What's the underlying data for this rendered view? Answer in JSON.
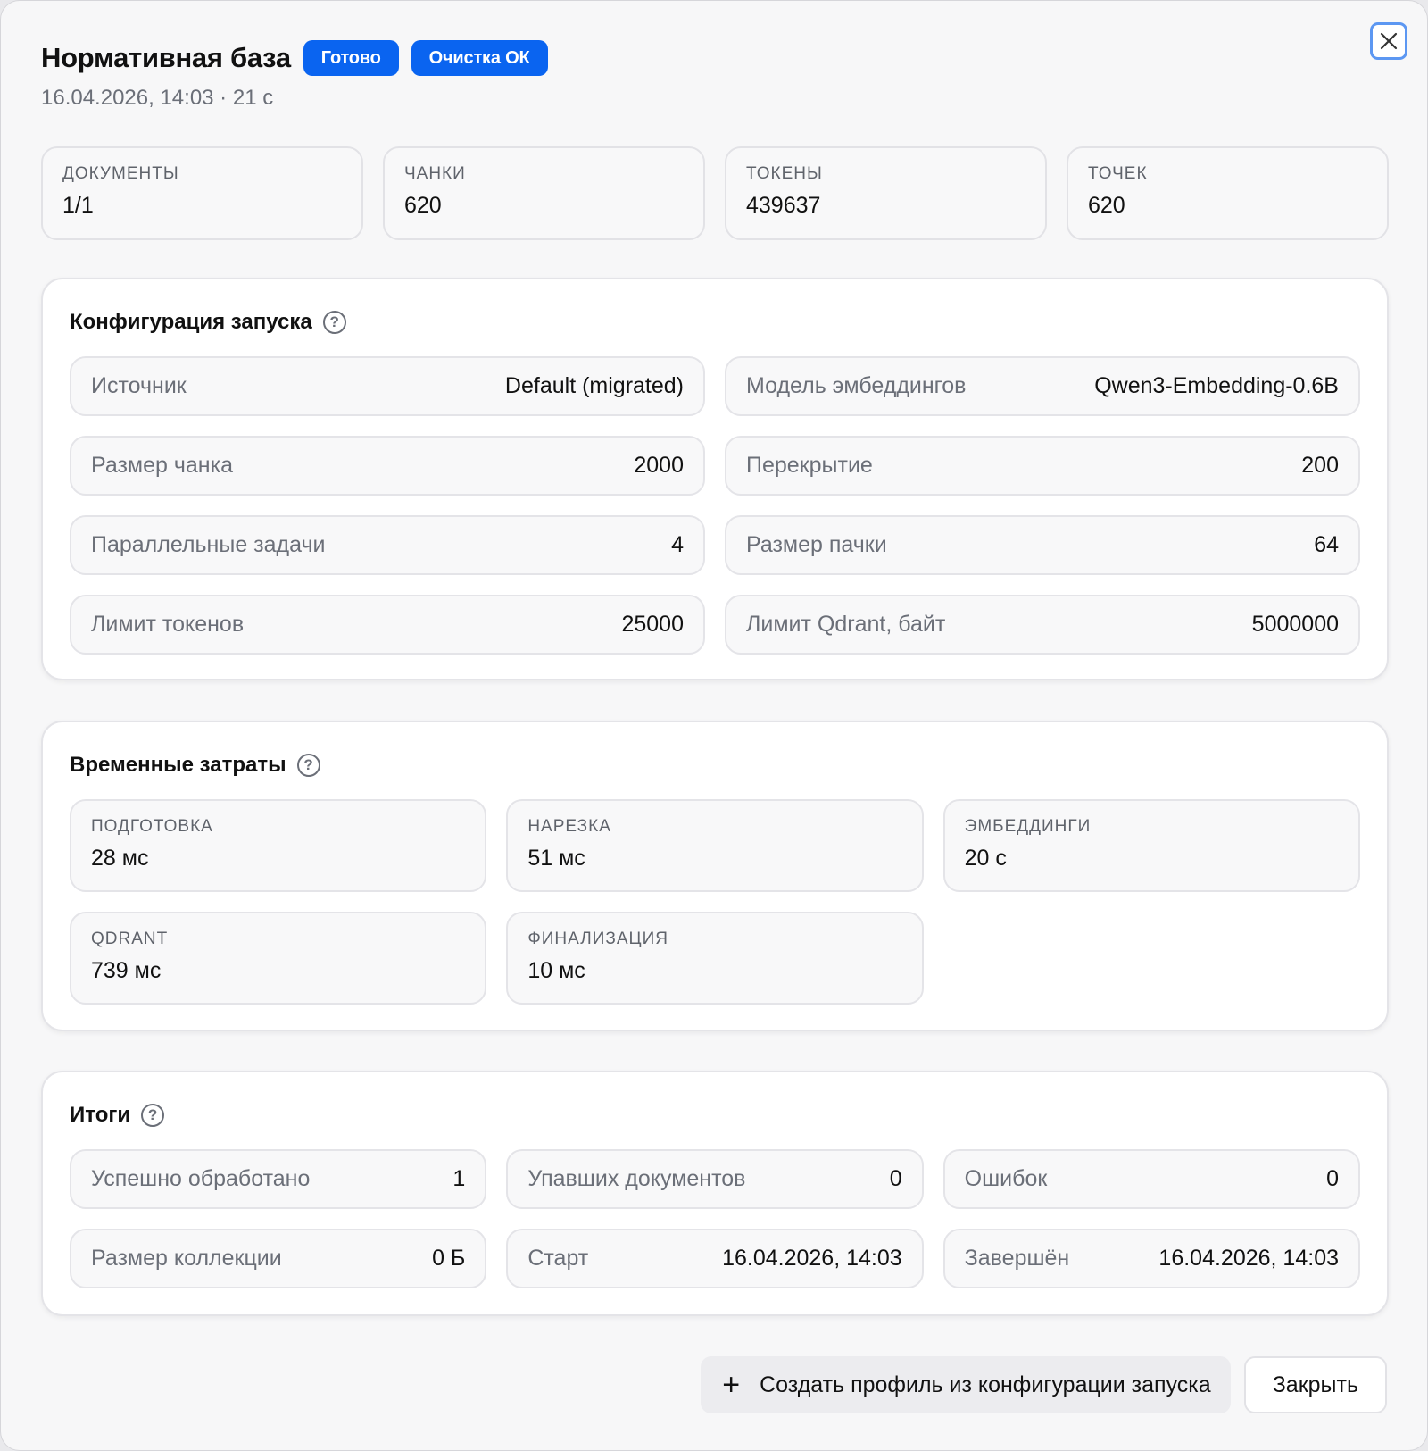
{
  "header": {
    "title": "Нормативная база",
    "badge_status": "Готово",
    "badge_cleanup": "Очистка ОК",
    "subtitle": "16.04.2026, 14:03 · 21 с"
  },
  "stats": [
    {
      "label": "ДОКУМЕНТЫ",
      "value": "1/1"
    },
    {
      "label": "ЧАНКИ",
      "value": "620"
    },
    {
      "label": "ТОКЕНЫ",
      "value": "439637"
    },
    {
      "label": "ТОЧЕК",
      "value": "620"
    }
  ],
  "config": {
    "title": "Конфигурация запуска",
    "rows": [
      {
        "label": "Источник",
        "value": "Default (migrated)"
      },
      {
        "label": "Модель эмбеддингов",
        "value": "Qwen3-Embedding-0.6B"
      },
      {
        "label": "Размер чанка",
        "value": "2000"
      },
      {
        "label": "Перекрытие",
        "value": "200"
      },
      {
        "label": "Параллельные задачи",
        "value": "4"
      },
      {
        "label": "Размер пачки",
        "value": "64"
      },
      {
        "label": "Лимит токенов",
        "value": "25000"
      },
      {
        "label": "Лимит Qdrant, байт",
        "value": "5000000"
      }
    ]
  },
  "timing": {
    "title": "Временные затраты",
    "cards": [
      {
        "label": "ПОДГОТОВКА",
        "value": "28 мс"
      },
      {
        "label": "НАРЕЗКА",
        "value": "51 мс"
      },
      {
        "label": "ЭМБЕДДИНГИ",
        "value": "20 с"
      },
      {
        "label": "QDRANT",
        "value": "739 мс"
      },
      {
        "label": "ФИНАЛИЗАЦИЯ",
        "value": "10 мс"
      }
    ]
  },
  "totals": {
    "title": "Итоги",
    "rows": [
      {
        "label": "Успешно обработано",
        "value": "1"
      },
      {
        "label": "Упавших документов",
        "value": "0"
      },
      {
        "label": "Ошибок",
        "value": "0"
      },
      {
        "label": "Размер коллекции",
        "value": "0 Б"
      },
      {
        "label": "Старт",
        "value": "16.04.2026, 14:03"
      },
      {
        "label": "Завершён",
        "value": "16.04.2026, 14:03"
      }
    ]
  },
  "footer": {
    "create_profile_label": "Создать профиль из конфигурации запуска",
    "close_label": "Закрыть"
  },
  "icons": {
    "help": "question-circle-icon",
    "close": "close-icon",
    "plus": "plus-icon"
  },
  "colors": {
    "accent": "#0a64f0",
    "focus_ring": "#5c97f2"
  }
}
